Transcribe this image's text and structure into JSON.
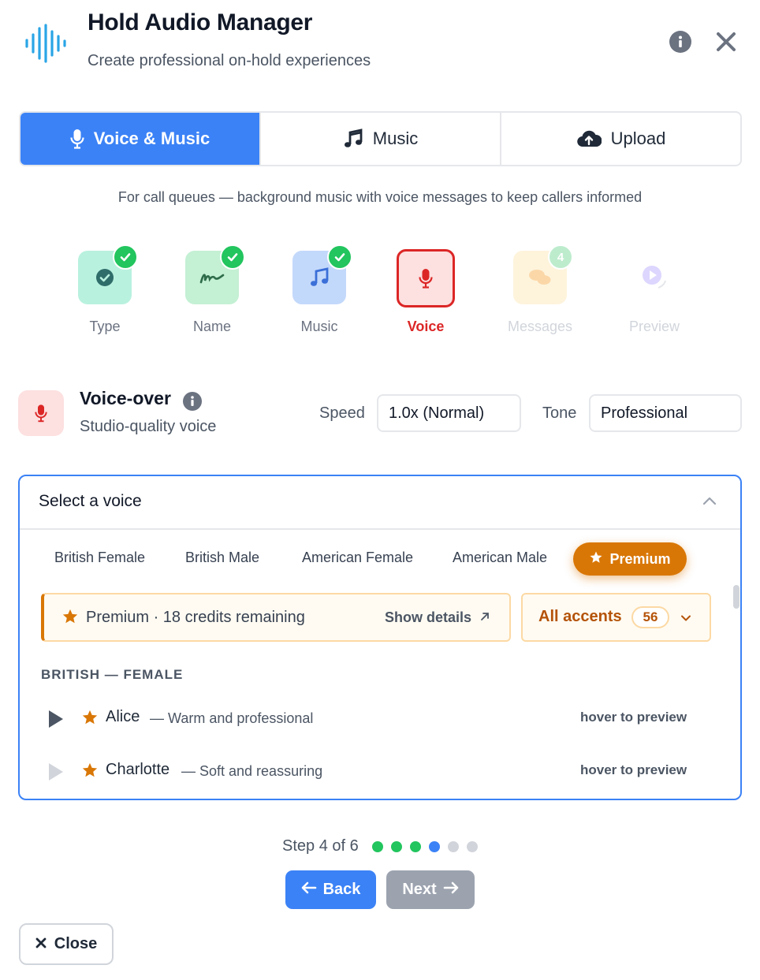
{
  "header": {
    "title": "Hold Audio Manager",
    "subtitle": "Create professional on-hold experiences",
    "logo_icon": "waveform-icon",
    "info_icon": "info-icon",
    "close_icon": "close-icon"
  },
  "tabs": [
    {
      "label": "Voice & Music",
      "icon": "microphone-icon",
      "active": true
    },
    {
      "label": "Music",
      "icon": "music-note-icon",
      "active": false
    },
    {
      "label": "Upload",
      "icon": "cloud-upload-icon",
      "active": false
    }
  ],
  "tagline": "For call queues — background music with voice messages to keep callers informed",
  "steps": [
    {
      "label": "Type",
      "status": "complete"
    },
    {
      "label": "Name",
      "status": "complete"
    },
    {
      "label": "Music",
      "status": "complete"
    },
    {
      "label": "Voice",
      "status": "current"
    },
    {
      "label": "Messages",
      "status": "upcoming",
      "badge": "4"
    },
    {
      "label": "Preview",
      "status": "upcoming"
    }
  ],
  "voiceover": {
    "title": "Voice-over",
    "subtitle": "Studio-quality voice",
    "speed_label": "Speed",
    "speed_value": "1.0x (Normal)",
    "tone_label": "Tone",
    "tone_value": "Professional"
  },
  "voice_panel": {
    "title": "Select a voice",
    "filters": [
      "British Female",
      "British Male",
      "American Female",
      "American Male"
    ],
    "premium_filter": "Premium",
    "credits_text": "Premium · 18 credits remaining",
    "show_details": "Show details",
    "accents_label": "All accents",
    "accents_count": "56",
    "group_heading": "BRITISH — FEMALE",
    "voices": [
      {
        "name": "Alice",
        "description": "— Warm and professional",
        "hint": "hover to preview"
      },
      {
        "name": "Charlotte",
        "description": "— Soft and reassuring",
        "hint": "hover to preview"
      }
    ]
  },
  "footer": {
    "step_text": "Step 4 of 6",
    "current_step": 4,
    "total_steps": 6,
    "back_label": "Back",
    "next_label": "Next",
    "close_label": "Close"
  },
  "colors": {
    "accent": "#3b82f6",
    "success": "#22c55e",
    "premium": "#d97706",
    "danger": "#dc2626"
  }
}
